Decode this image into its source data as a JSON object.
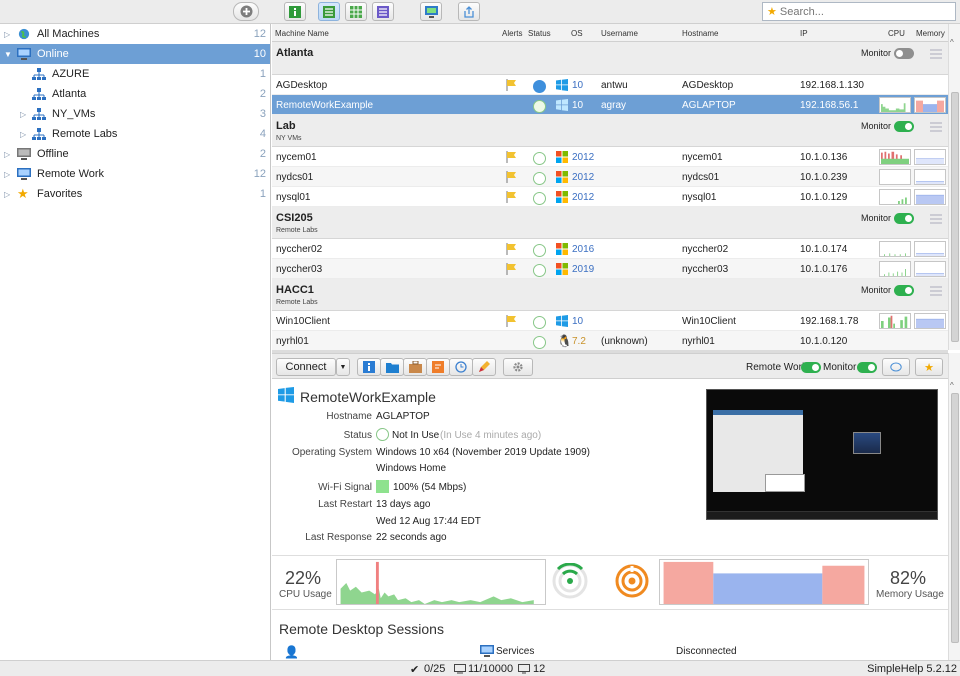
{
  "toolbar": {
    "search_placeholder": "Search..."
  },
  "sidebar": {
    "items": [
      {
        "label": "All Machines",
        "count": "12"
      },
      {
        "label": "Online",
        "count": "10"
      },
      {
        "label": "AZURE",
        "count": "1"
      },
      {
        "label": "Atlanta",
        "count": "2"
      },
      {
        "label": "NY_VMs",
        "count": "3"
      },
      {
        "label": "Remote Labs",
        "count": "4"
      },
      {
        "label": "Offline",
        "count": "2"
      },
      {
        "label": "Remote Work",
        "count": "12"
      },
      {
        "label": "Favorites",
        "count": "1"
      }
    ]
  },
  "table": {
    "columns": {
      "name": "Machine Name",
      "alerts": "Alerts",
      "status": "Status",
      "os": "OS",
      "username": "Username",
      "hostname": "Hostname",
      "ip": "IP",
      "cpu": "CPU",
      "memory": "Memory"
    },
    "monitor_label": "Monitor",
    "groups": [
      {
        "name": "Atlanta",
        "sub": ""
      },
      {
        "name": "Lab",
        "sub": "NY VMs"
      },
      {
        "name": "CSI205",
        "sub": "Remote Labs"
      },
      {
        "name": "HACC1",
        "sub": "Remote Labs"
      }
    ],
    "rows": [
      {
        "name": "AGDesktop",
        "os": "10",
        "user": "antwu",
        "host": "AGDesktop",
        "ip": "192.168.1.130"
      },
      {
        "name": "RemoteWorkExample",
        "os": "10",
        "user": "agray",
        "host": "AGLAPTOP",
        "ip": "192.168.56.1"
      },
      {
        "name": "nycem01",
        "os": "2012",
        "user": "",
        "host": "nycem01",
        "ip": "10.1.0.136"
      },
      {
        "name": "nydcs01",
        "os": "2012",
        "user": "",
        "host": "nydcs01",
        "ip": "10.1.0.239"
      },
      {
        "name": "nysql01",
        "os": "2012",
        "user": "",
        "host": "nysql01",
        "ip": "10.1.0.129"
      },
      {
        "name": "nyccher02",
        "os": "2016",
        "user": "",
        "host": "nyccher02",
        "ip": "10.1.0.174"
      },
      {
        "name": "nyccher03",
        "os": "2019",
        "user": "",
        "host": "nyccher03",
        "ip": "10.1.0.176"
      },
      {
        "name": "Win10Client",
        "os": "10",
        "user": "",
        "host": "Win10Client",
        "ip": "192.168.1.78"
      },
      {
        "name": "nyrhl01",
        "os": "7.2",
        "user": "(unknown)",
        "host": "nyrhl01",
        "ip": "10.1.0.120"
      }
    ]
  },
  "detail_toolbar": {
    "connect": "Connect",
    "remote_work": "Remote Work",
    "monitor": "Monitor"
  },
  "detail": {
    "title": "RemoteWorkExample",
    "labels": {
      "hostname": "Hostname",
      "status": "Status",
      "os": "Operating System",
      "wifi": "Wi-Fi Signal",
      "restart": "Last Restart",
      "response": "Last Response"
    },
    "hostname": "AGLAPTOP",
    "status": "Not In Use",
    "status_note": "(In Use 4 minutes ago)",
    "os": "Windows 10 x64 (November 2019 Update 1909)",
    "os_edition": "Windows Home",
    "wifi": "100% (54 Mbps)",
    "restart": "13 days ago",
    "restart_date": "Wed 12 Aug 17:44 EDT",
    "response": "22 seconds ago",
    "cpu_value": "22%",
    "cpu_label": "CPU Usage",
    "mem_value": "82%",
    "mem_label": "Memory Usage",
    "sessions_title": "Remote Desktop Sessions",
    "session_type": "Services",
    "session_state": "Disconnected"
  },
  "statusbar": {
    "tools": "0/25",
    "licenses": "11/10000",
    "machines": "12",
    "version": "SimpleHelp 5.2.12"
  },
  "colors": {
    "selected": "#6d9fd5",
    "toggle_on": "#2eb04f",
    "accent_blue": "#3e8fdc"
  }
}
